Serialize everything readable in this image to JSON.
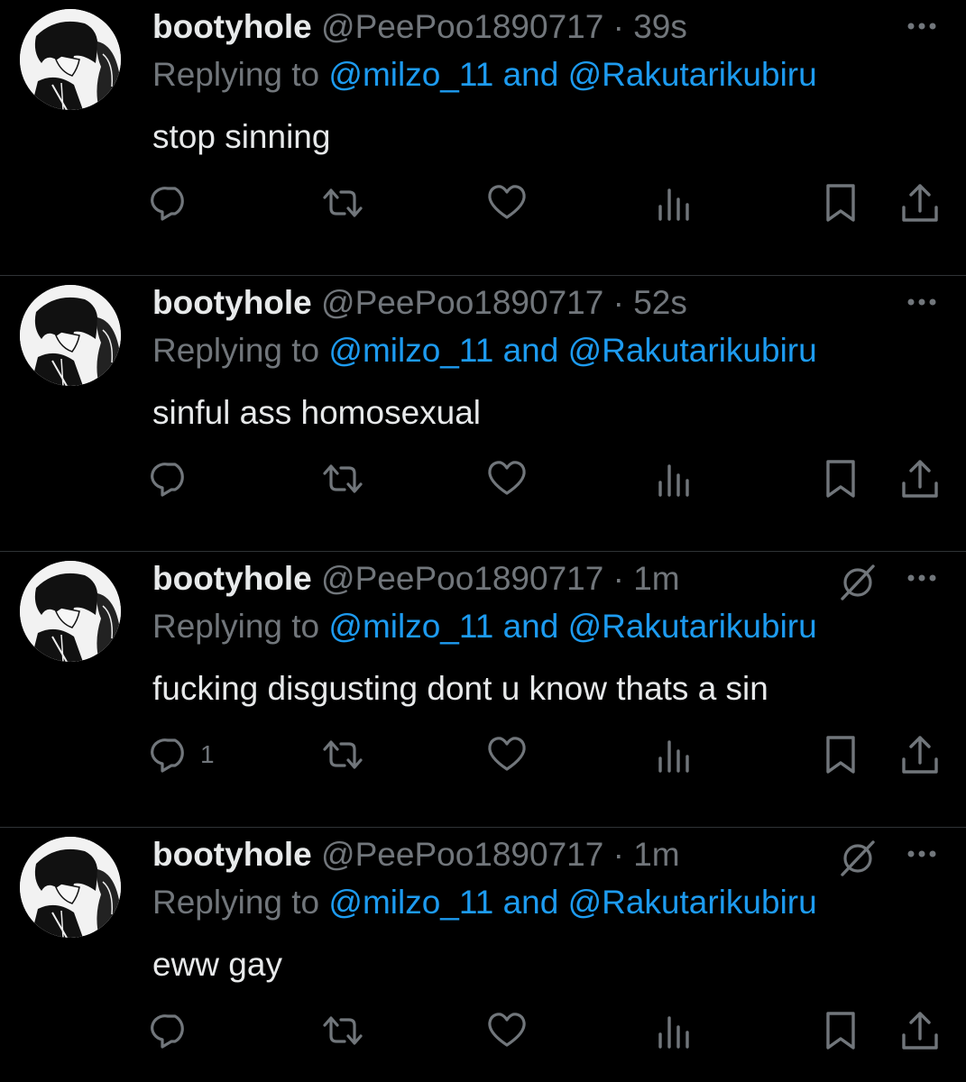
{
  "colors": {
    "background": "#000000",
    "text_primary": "#e7e9ea",
    "text_secondary": "#71767b",
    "accent": "#1d9bf0",
    "divider": "#2f3336"
  },
  "tweets": [
    {
      "display_name": "bootyhole",
      "handle": "@PeePoo1890717",
      "separator": "·",
      "time": "39s",
      "muted_icon": false,
      "replying_prefix": "Replying to",
      "reply_mention_1": "@milzo_11",
      "reply_joiner": "and",
      "reply_mention_2": "@Rakutarikubiru",
      "text": "stop sinning",
      "reply_count": ""
    },
    {
      "display_name": "bootyhole",
      "handle": "@PeePoo1890717",
      "separator": "·",
      "time": "52s",
      "muted_icon": false,
      "replying_prefix": "Replying to",
      "reply_mention_1": "@milzo_11",
      "reply_joiner": "and",
      "reply_mention_2": "@Rakutarikubiru",
      "text": "sinful ass homosexual",
      "reply_count": ""
    },
    {
      "display_name": "bootyhole",
      "handle": "@PeePoo1890717",
      "separator": "·",
      "time": "1m",
      "muted_icon": true,
      "replying_prefix": "Replying to",
      "reply_mention_1": "@milzo_11",
      "reply_joiner": "and",
      "reply_mention_2": "@Rakutarikubiru",
      "text": "fucking disgusting dont u know thats a sin",
      "reply_count": "1"
    },
    {
      "display_name": "bootyhole",
      "handle": "@PeePoo1890717",
      "separator": "·",
      "time": "1m",
      "muted_icon": true,
      "replying_prefix": "Replying to",
      "reply_mention_1": "@milzo_11",
      "reply_joiner": "and",
      "reply_mention_2": "@Rakutarikubiru",
      "text": "eww gay",
      "reply_count": ""
    }
  ],
  "icons": {
    "reply": "reply-icon",
    "retweet": "retweet-icon",
    "like": "heart-icon",
    "views": "views-icon",
    "bookmark": "bookmark-icon",
    "share": "share-icon",
    "more": "more-icon",
    "muted": "muted-icon"
  }
}
